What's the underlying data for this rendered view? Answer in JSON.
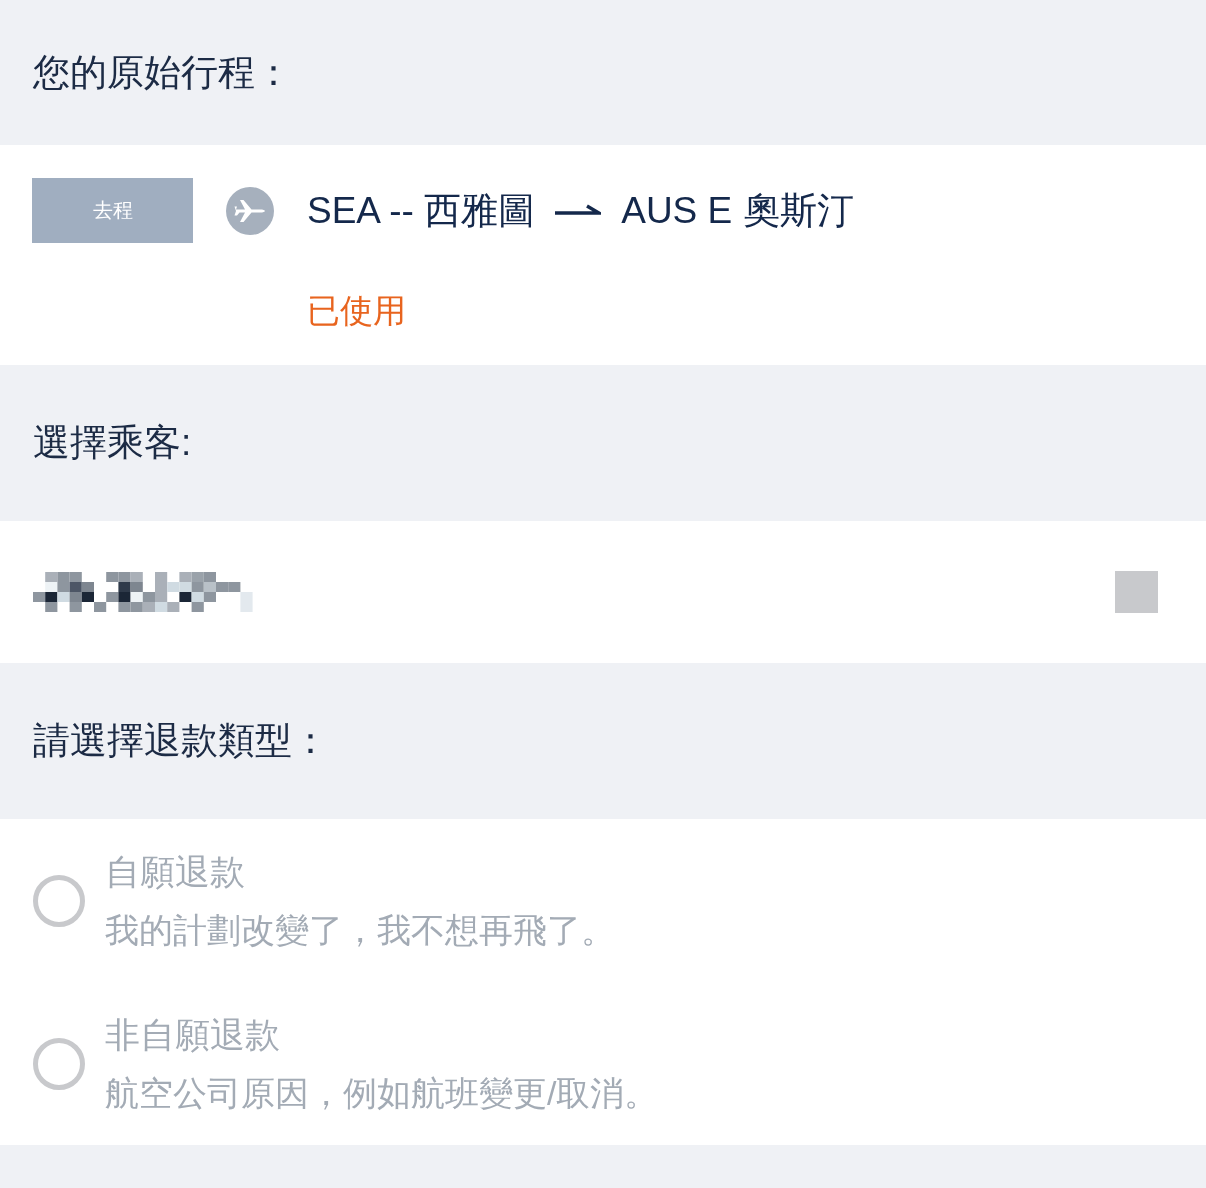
{
  "itinerary": {
    "title": "您的原始行程：",
    "segments": [
      {
        "tag": "去程",
        "origin": "SEA -- 西雅圖",
        "destination": "AUS E 奧斯汀",
        "status": "已使用"
      }
    ]
  },
  "passengers": {
    "title": "選擇乘客:",
    "items": [
      {
        "checked": false,
        "disabled": true
      }
    ]
  },
  "refund_type": {
    "title": "請選擇退款類型：",
    "options": [
      {
        "label": "自願退款",
        "description": "我的計劃改變了，我不想再飛了。",
        "selected": false,
        "disabled": true
      },
      {
        "label": "非自願退款",
        "description": "航空公司原因，例如航班變更/取消。",
        "selected": false,
        "disabled": true
      }
    ]
  }
}
